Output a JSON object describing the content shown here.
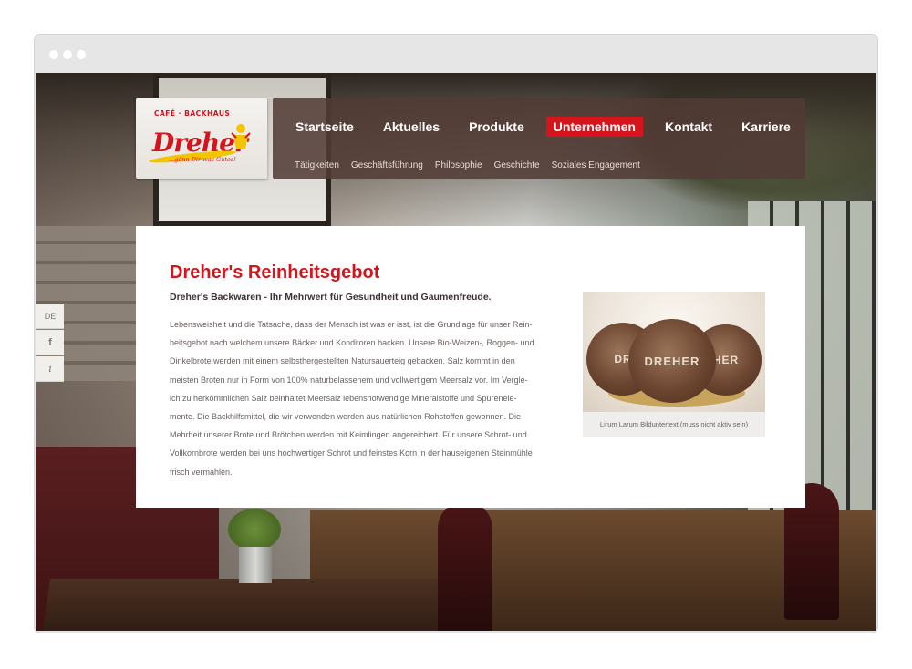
{
  "logo": {
    "top_text": "CAFÉ · BACKHAUS",
    "name": "Dreher",
    "tagline": "...gönn Dir was Gutes!"
  },
  "nav": {
    "main": [
      {
        "label": "Startseite",
        "active": false
      },
      {
        "label": "Aktuelles",
        "active": false
      },
      {
        "label": "Produkte",
        "active": false
      },
      {
        "label": "Unternehmen",
        "active": true
      },
      {
        "label": "Kontakt",
        "active": false
      },
      {
        "label": "Karriere",
        "active": false
      }
    ],
    "sub": [
      "Tätigkeiten",
      "Geschäftsführung",
      "Philosophie",
      "Geschichte",
      "Soziales Engagement"
    ]
  },
  "side": {
    "language": "DE",
    "facebook": "f",
    "info": "i"
  },
  "content": {
    "title": "Dreher's Reinheitsgebot",
    "subtitle": "Dreher's Backwaren - Ihr Mehrwert für Gesundheit und Gaumenfreude.",
    "body_lines": [
      "Lebensweisheit und die Tatsache, dass der Mensch ist was er isst, ist die Grundlage für unser Rein-",
      "heitsgebot nach welchem unsere Bäcker und Konditoren backen. Unsere Bio-Weizen-, Roggen- und",
      "Dinkelbrote werden mit einem selbsthergestellten Natursauerteig gebacken. Salz kommt in den",
      "meisten Broten nur in Form von 100% naturbelassenem und vollwertigem Meersalz vor. Im Vergle-",
      "ich zu herkömmlichen Salz beinhaltet Meersalz lebensnotwendige Mineralstoffe und Spurenele-",
      "mente. Die Backhilfsmittel, die wir verwenden werden aus natürlichen Rohstoffen gewonnen. Die",
      "Mehrheit unserer Brote und Brötchen werden mit Keimlingen angereichert. Für unsere Schrot- und",
      "Vollkornbrote werden bei uns hochwertiger Schrot und feinstes Korn in der hauseigenen Steinmühle",
      "frisch vermahlen."
    ],
    "image_caption": "Lirum Larum Bilduntertext (muss nicht aktiv sein)",
    "bread_letters": [
      "DR",
      "DREHER",
      "HER"
    ]
  },
  "colors": {
    "accent": "#d6141c",
    "nav_bg": "#523a34",
    "text": "#6a6260"
  }
}
